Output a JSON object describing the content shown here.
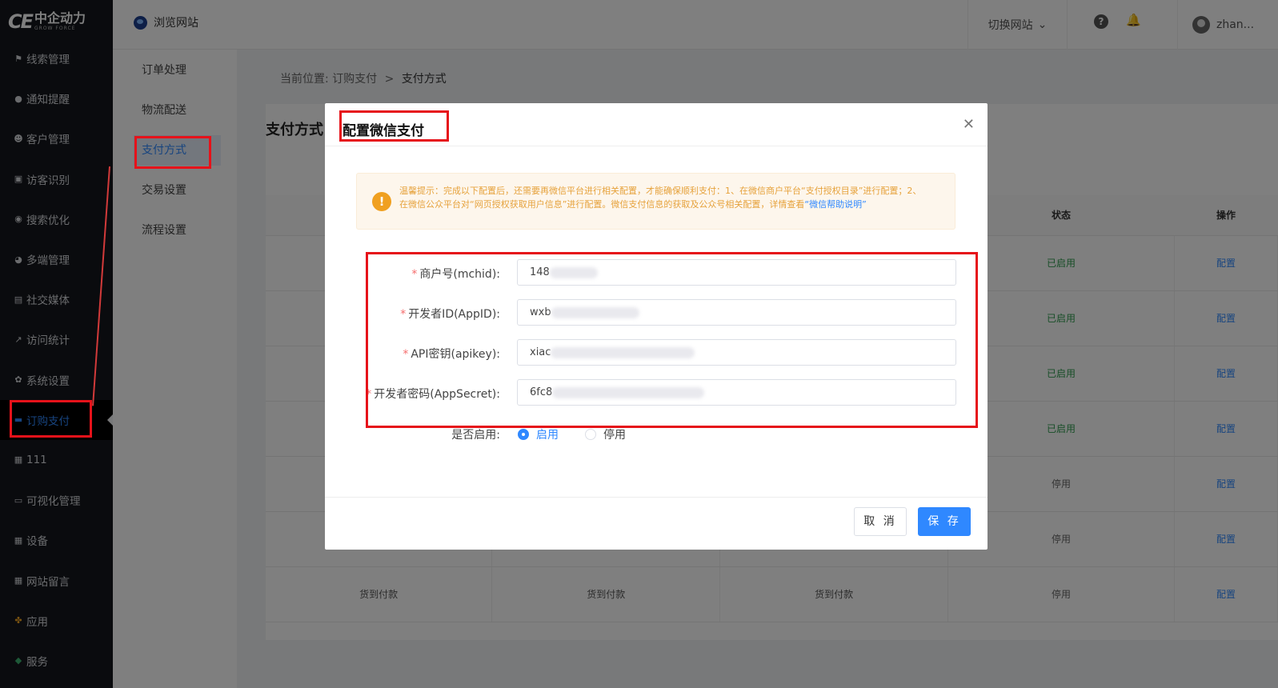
{
  "app": {
    "logo_mark": "CE",
    "logo_cn": "中企动力",
    "logo_en": "GROW FORCE"
  },
  "sidebar": {
    "items": [
      {
        "label": "线索管理",
        "icon": "flag-icon"
      },
      {
        "label": "通知提醒",
        "icon": "chat-icon"
      },
      {
        "label": "客户管理",
        "icon": "users-icon"
      },
      {
        "label": "访客识别",
        "icon": "id-card-icon"
      },
      {
        "label": "搜索优化",
        "icon": "target-icon"
      },
      {
        "label": "多端管理",
        "icon": "compass-icon"
      },
      {
        "label": "社交媒体",
        "icon": "media-icon"
      },
      {
        "label": "访问统计",
        "icon": "line-chart-icon"
      },
      {
        "label": "系统设置",
        "icon": "gear-icon"
      },
      {
        "label": "订购支付",
        "icon": "cart-icon",
        "active": true
      },
      {
        "label": "111",
        "icon": "document-icon"
      },
      {
        "label": "可视化管理",
        "icon": "monitor-icon"
      },
      {
        "label": "设备",
        "icon": "document-icon"
      },
      {
        "label": "网站留言",
        "icon": "document-icon"
      },
      {
        "label": "应用",
        "icon": "apps-icon"
      },
      {
        "label": "服务",
        "icon": "cube-icon"
      }
    ]
  },
  "topbar": {
    "browse_label": "浏览网站",
    "switch_site": "切换网站",
    "user": "zhan..."
  },
  "submenu": {
    "items": [
      "订单处理",
      "物流配送",
      "支付方式",
      "交易设置",
      "流程设置"
    ]
  },
  "breadcrumb": {
    "prefix": "当前位置:",
    "parent": "订购支付",
    "sep": ">",
    "current": "支付方式"
  },
  "panel": {
    "title": "支付方式"
  },
  "table": {
    "headers": [
      "",
      "",
      "",
      "状态",
      "操作"
    ],
    "rows": [
      [
        "",
        "",
        "",
        "已启用",
        "配置"
      ],
      [
        "",
        "",
        "",
        "已启用",
        "配置"
      ],
      [
        "",
        "",
        "",
        "已启用",
        "配置"
      ],
      [
        "",
        "",
        "",
        "已启用",
        "配置"
      ],
      [
        "",
        "",
        "",
        "停用",
        "配置"
      ],
      [
        "",
        "",
        "",
        "停用",
        "配置"
      ],
      [
        "货到付款",
        "货到付款",
        "货到付款",
        "停用",
        "配置"
      ]
    ]
  },
  "modal": {
    "title": "配置微信支付",
    "notice": "温馨提示：完成以下配置后，还需要再微信平台进行相关配置，才能确保顺利支付：1、在微信商户平台“支付授权目录”进行配置；2、在微信公众平台对“网页授权获取用户信息”进行配置。微信支付信息的获取及公众号相关配置，详情查看",
    "notice_link": "“微信帮助说明”",
    "fields": [
      {
        "label": "商户号(mchid):",
        "value": "148"
      },
      {
        "label": "开发者ID(AppID):",
        "value": "wxb"
      },
      {
        "label": "API密钥(apikey):",
        "value": "xiac"
      },
      {
        "label": "开发者密码(AppSecret):",
        "value": "6fc8"
      }
    ],
    "enable_label": "是否启用:",
    "enable_on": "启用",
    "enable_off": "停用",
    "cancel": "取 消",
    "save": "保 存"
  },
  "colors": {
    "accent": "#2f88ff",
    "highlight": "#e6121a",
    "sidebar_bg": "#14171c"
  }
}
